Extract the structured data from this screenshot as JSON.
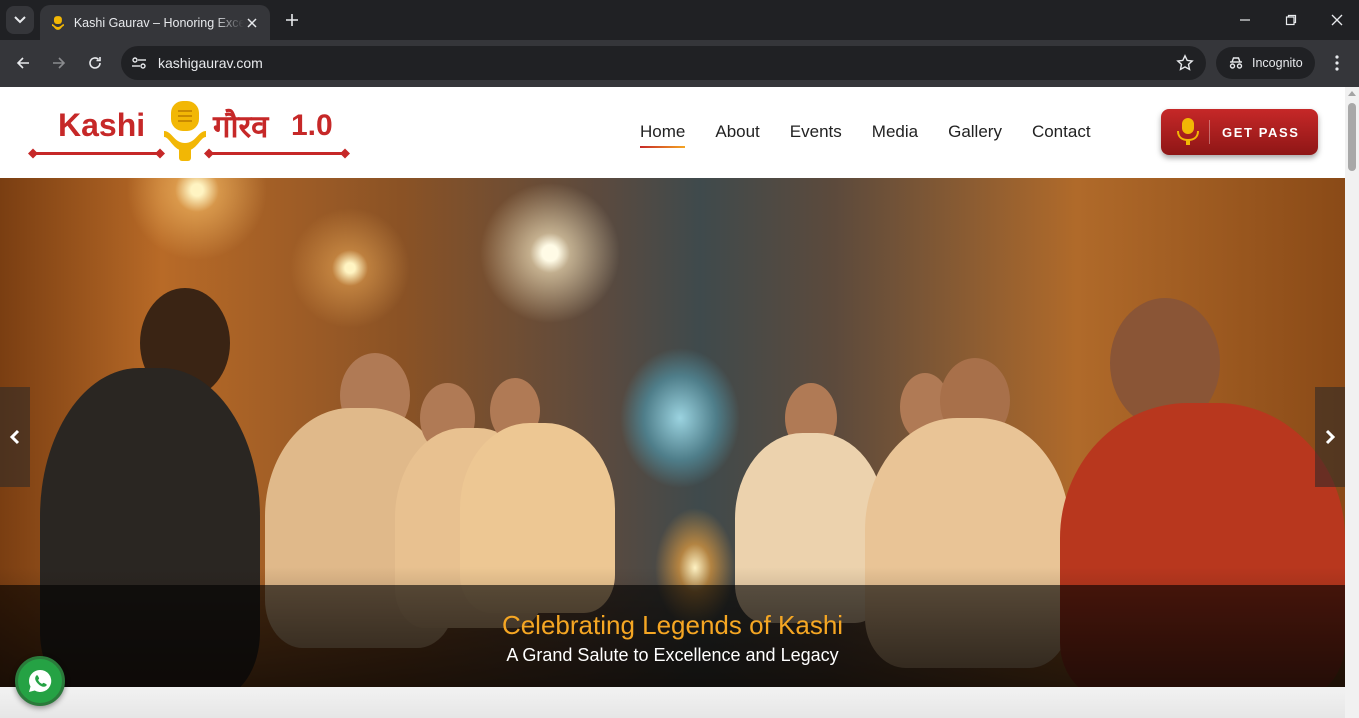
{
  "browser": {
    "tab": {
      "title": "Kashi Gaurav – Honoring Excellence",
      "favicon": "kashi-logo-icon"
    },
    "new_tab_icon": "plus-icon",
    "url": "kashigaurav.com",
    "profile": "Incognito",
    "window_controls": [
      "minimize-icon",
      "restore-icon",
      "close-icon"
    ]
  },
  "site": {
    "logo": {
      "en": "Kashi",
      "hi": "गौरव",
      "version": "1.0"
    },
    "nav": [
      {
        "label": "Home",
        "active": true
      },
      {
        "label": "About"
      },
      {
        "label": "Events"
      },
      {
        "label": "Media"
      },
      {
        "label": "Gallery"
      },
      {
        "label": "Contact"
      }
    ],
    "cta": {
      "label": "GET PASS",
      "icon": "mic-icon"
    }
  },
  "hero": {
    "title": "Celebrating Legends of Kashi",
    "subtitle": "A Grand Salute to Excellence and Legacy",
    "prev_icon": "chevron-left-icon",
    "next_icon": "chevron-right-icon"
  },
  "floating": {
    "whatsapp_icon": "whatsapp-icon"
  },
  "colors": {
    "brand_red": "#c62828",
    "accent_gold": "#f5a623",
    "chrome_dark": "#202124",
    "chrome_mid": "#35363a"
  }
}
